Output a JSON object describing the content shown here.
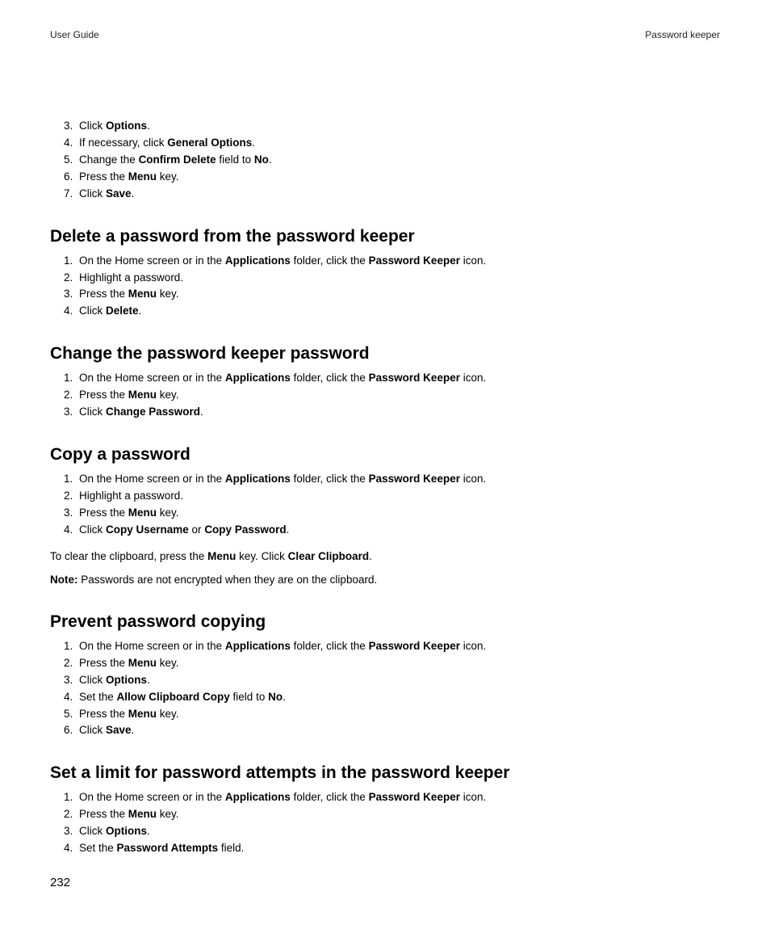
{
  "header": {
    "left": "User Guide",
    "right": "Password keeper"
  },
  "pageNumber": "232",
  "initialSteps": [
    [
      {
        "t": "Click "
      },
      {
        "b": "Options"
      },
      {
        "t": "."
      }
    ],
    [
      {
        "t": "If necessary, click "
      },
      {
        "b": "General Options"
      },
      {
        "t": "."
      }
    ],
    [
      {
        "t": "Change the "
      },
      {
        "b": "Confirm Delete"
      },
      {
        "t": " field to "
      },
      {
        "b": "No"
      },
      {
        "t": "."
      }
    ],
    [
      {
        "t": "Press the "
      },
      {
        "b": "Menu"
      },
      {
        "t": " key."
      }
    ],
    [
      {
        "t": "Click "
      },
      {
        "b": "Save"
      },
      {
        "t": "."
      }
    ]
  ],
  "initialStart": 3,
  "sections": [
    {
      "heading": "Delete a password from the password keeper",
      "steps": [
        [
          {
            "t": "On the Home screen or in the "
          },
          {
            "b": "Applications"
          },
          {
            "t": " folder, click the "
          },
          {
            "b": "Password Keeper"
          },
          {
            "t": " icon."
          }
        ],
        [
          {
            "t": "Highlight a password."
          }
        ],
        [
          {
            "t": "Press the "
          },
          {
            "b": "Menu"
          },
          {
            "t": " key."
          }
        ],
        [
          {
            "t": "Click "
          },
          {
            "b": "Delete"
          },
          {
            "t": "."
          }
        ]
      ]
    },
    {
      "heading": "Change the password keeper password",
      "steps": [
        [
          {
            "t": "On the Home screen or in the "
          },
          {
            "b": "Applications"
          },
          {
            "t": " folder, click the "
          },
          {
            "b": "Password Keeper"
          },
          {
            "t": " icon."
          }
        ],
        [
          {
            "t": "Press the "
          },
          {
            "b": "Menu"
          },
          {
            "t": " key."
          }
        ],
        [
          {
            "t": "Click "
          },
          {
            "b": "Change Password"
          },
          {
            "t": "."
          }
        ]
      ]
    },
    {
      "heading": "Copy a password",
      "steps": [
        [
          {
            "t": "On the Home screen or in the "
          },
          {
            "b": "Applications"
          },
          {
            "t": " folder, click the "
          },
          {
            "b": "Password Keeper"
          },
          {
            "t": " icon."
          }
        ],
        [
          {
            "t": "Highlight a password."
          }
        ],
        [
          {
            "t": "Press the "
          },
          {
            "b": "Menu"
          },
          {
            "t": " key."
          }
        ],
        [
          {
            "t": "Click "
          },
          {
            "b": "Copy Username"
          },
          {
            "t": " or "
          },
          {
            "b": "Copy Password"
          },
          {
            "t": "."
          }
        ]
      ],
      "afterParas": [
        [
          {
            "t": "To clear the clipboard, press the "
          },
          {
            "b": "Menu"
          },
          {
            "t": " key. Click "
          },
          {
            "b": "Clear Clipboard"
          },
          {
            "t": "."
          }
        ],
        [
          {
            "b": "Note:"
          },
          {
            "t": "  Passwords are not encrypted when they are on the clipboard."
          }
        ]
      ]
    },
    {
      "heading": "Prevent password copying",
      "steps": [
        [
          {
            "t": "On the Home screen or in the "
          },
          {
            "b": "Applications"
          },
          {
            "t": " folder, click the "
          },
          {
            "b": "Password Keeper"
          },
          {
            "t": " icon."
          }
        ],
        [
          {
            "t": "Press the "
          },
          {
            "b": "Menu"
          },
          {
            "t": " key."
          }
        ],
        [
          {
            "t": "Click "
          },
          {
            "b": "Options"
          },
          {
            "t": "."
          }
        ],
        [
          {
            "t": "Set the "
          },
          {
            "b": "Allow Clipboard Copy"
          },
          {
            "t": " field to "
          },
          {
            "b": "No"
          },
          {
            "t": "."
          }
        ],
        [
          {
            "t": "Press the "
          },
          {
            "b": "Menu"
          },
          {
            "t": " key."
          }
        ],
        [
          {
            "t": "Click "
          },
          {
            "b": "Save"
          },
          {
            "t": "."
          }
        ]
      ]
    },
    {
      "heading": "Set a limit for password attempts in the password keeper",
      "steps": [
        [
          {
            "t": "On the Home screen or in the "
          },
          {
            "b": "Applications"
          },
          {
            "t": " folder, click the "
          },
          {
            "b": "Password Keeper"
          },
          {
            "t": " icon."
          }
        ],
        [
          {
            "t": "Press the "
          },
          {
            "b": "Menu"
          },
          {
            "t": " key."
          }
        ],
        [
          {
            "t": "Click "
          },
          {
            "b": "Options"
          },
          {
            "t": "."
          }
        ],
        [
          {
            "t": "Set the "
          },
          {
            "b": "Password Attempts"
          },
          {
            "t": " field."
          }
        ]
      ]
    }
  ]
}
